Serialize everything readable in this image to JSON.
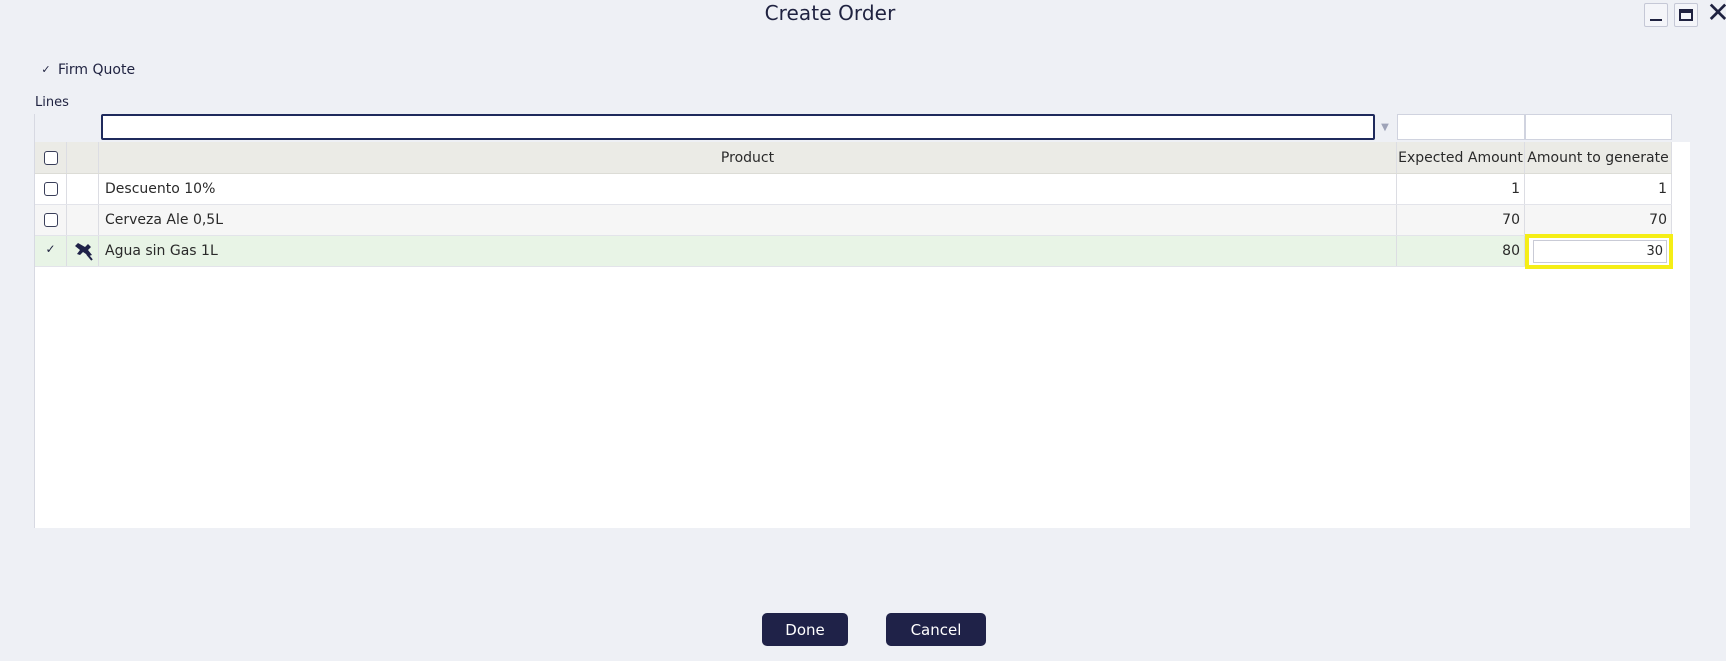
{
  "window": {
    "title": "Create Order",
    "controls": [
      "minimize-icon",
      "maximize-icon",
      "close-icon"
    ],
    "close_glyph": "✕"
  },
  "firm_quote": {
    "label": "Firm Quote",
    "checked": true,
    "check_glyph": "✓"
  },
  "lines": {
    "label": "Lines",
    "columns": {
      "product": "Product",
      "expected_amount": "Expected Amount",
      "amount_to_generate": "Amount to generate"
    },
    "filter_arrow": "▼",
    "rows": [
      {
        "selected": false,
        "product": "Descuento 10%",
        "expected_amount": "1",
        "amount_to_generate": "1"
      },
      {
        "selected": false,
        "product": "Cerveza Ale 0,5L",
        "expected_amount": "70",
        "amount_to_generate": "70"
      },
      {
        "selected": true,
        "check_glyph": "✓",
        "icon": "pin-icon",
        "product": "Agua sin Gas 1L",
        "expected_amount": "80",
        "amount_to_generate": "30"
      }
    ]
  },
  "footer": {
    "done_label": "Done",
    "cancel_label": "Cancel"
  },
  "colors": {
    "accent": "#1f2248",
    "highlight": "#f5ee16",
    "selected_row": "#e8f4e6",
    "header_bg": "#ebebe6",
    "background": "#eef0f5"
  }
}
